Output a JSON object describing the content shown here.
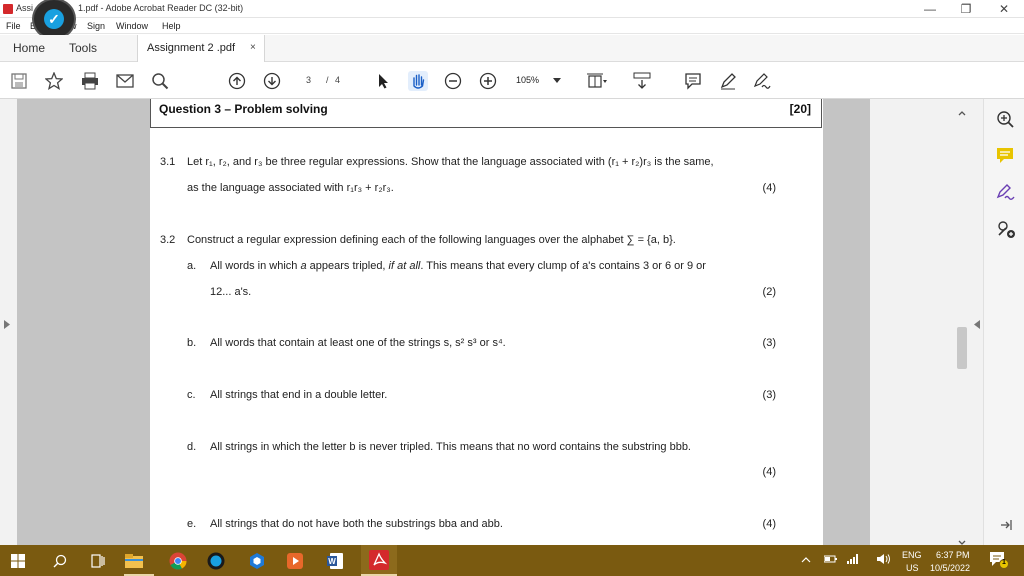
{
  "window": {
    "title_left": "Assi",
    "title_right": "1.pdf - Adobe Acrobat Reader DC (32-bit)",
    "minimize": "—",
    "maximize": "❐",
    "close": "✕"
  },
  "menu": {
    "file": "File",
    "edit": "E",
    "view": "w",
    "sign": "Sign",
    "window": "Window",
    "help": "Help"
  },
  "tabs": {
    "home": "Home",
    "tools": "Tools",
    "doc": "Assignment 2 .pdf",
    "close": "×"
  },
  "toolbar": {
    "page_current": "3",
    "page_sep": "/",
    "page_total": "4",
    "zoom": "105%"
  },
  "document": {
    "question_title": "Question 3 – Problem solving",
    "question_marks": "[20]",
    "q31_num": "3.1",
    "q31_line1": "Let r₁, r₂, and r₃ be three regular expressions. Show that the language associated with (r₁ + r₂)r₃ is the same,",
    "q31_line2": "as the language associated with r₁r₃ + r₂r₃.",
    "q31_mark": "(4)",
    "q32_num": "3.2",
    "q32_line": "Construct a regular expression defining each of the following languages over the alphabet ∑ = {a, b}.",
    "a_label": "a.",
    "a_pre": "All words in which ",
    "a_em": "a",
    "a_mid": " appears tripled, ",
    "a_em2": "if at all",
    "a_post": ". This means that every clump of a's contains 3 or 6 or 9 or",
    "a_line2": "12... a's.",
    "a_mark": "(2)",
    "b_label": "b.",
    "b_text": "All words that contain at least one of the strings s, s² s³ or s⁴.",
    "b_mark": "(3)",
    "c_label": "c.",
    "c_text": "All strings that end in a double letter.",
    "c_mark": "(3)",
    "d_label": "d.",
    "d_text": "All strings in which the letter b is never tripled. This means that no word contains the substring bbb.",
    "d_mark": "(4)",
    "e_label": "e.",
    "e_text": "All strings that do not have both the substrings bba and abb.",
    "e_mark": "(4)"
  },
  "taskbar": {
    "lang": "ENG",
    "region": "US",
    "time": "6:37 PM",
    "date": "10/5/2022",
    "notif_count": "1",
    "word_letter": "W"
  },
  "colors": {
    "taskbar": "#7a5a10",
    "acrobat_red": "#d4292c",
    "yellow_comment": "#e8c400"
  }
}
